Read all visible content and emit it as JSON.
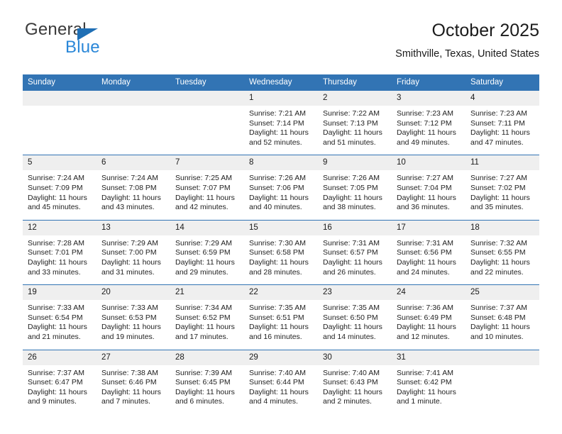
{
  "brand": {
    "name_part1": "General",
    "name_part2": "Blue",
    "logo_icon": "blue-triangle-logo"
  },
  "header": {
    "title": "October 2025",
    "subtitle": "Smithville, Texas, United States"
  },
  "calendar": {
    "weekday_headers": [
      "Sunday",
      "Monday",
      "Tuesday",
      "Wednesday",
      "Thursday",
      "Friday",
      "Saturday"
    ],
    "colors": {
      "header_blue": "#3274b4",
      "daynum_band": "#efefef",
      "brand_blue": "#2a87d8",
      "logo_blue": "#1f6fb5"
    },
    "weeks": [
      [
        {
          "day": "",
          "empty": true
        },
        {
          "day": "",
          "empty": true
        },
        {
          "day": "",
          "empty": true
        },
        {
          "day": "1",
          "sunrise": "Sunrise: 7:21 AM",
          "sunset": "Sunset: 7:14 PM",
          "daylight_line1": "Daylight: 11 hours",
          "daylight_line2": "and 52 minutes."
        },
        {
          "day": "2",
          "sunrise": "Sunrise: 7:22 AM",
          "sunset": "Sunset: 7:13 PM",
          "daylight_line1": "Daylight: 11 hours",
          "daylight_line2": "and 51 minutes."
        },
        {
          "day": "3",
          "sunrise": "Sunrise: 7:23 AM",
          "sunset": "Sunset: 7:12 PM",
          "daylight_line1": "Daylight: 11 hours",
          "daylight_line2": "and 49 minutes."
        },
        {
          "day": "4",
          "sunrise": "Sunrise: 7:23 AM",
          "sunset": "Sunset: 7:11 PM",
          "daylight_line1": "Daylight: 11 hours",
          "daylight_line2": "and 47 minutes."
        }
      ],
      [
        {
          "day": "5",
          "sunrise": "Sunrise: 7:24 AM",
          "sunset": "Sunset: 7:09 PM",
          "daylight_line1": "Daylight: 11 hours",
          "daylight_line2": "and 45 minutes."
        },
        {
          "day": "6",
          "sunrise": "Sunrise: 7:24 AM",
          "sunset": "Sunset: 7:08 PM",
          "daylight_line1": "Daylight: 11 hours",
          "daylight_line2": "and 43 minutes."
        },
        {
          "day": "7",
          "sunrise": "Sunrise: 7:25 AM",
          "sunset": "Sunset: 7:07 PM",
          "daylight_line1": "Daylight: 11 hours",
          "daylight_line2": "and 42 minutes."
        },
        {
          "day": "8",
          "sunrise": "Sunrise: 7:26 AM",
          "sunset": "Sunset: 7:06 PM",
          "daylight_line1": "Daylight: 11 hours",
          "daylight_line2": "and 40 minutes."
        },
        {
          "day": "9",
          "sunrise": "Sunrise: 7:26 AM",
          "sunset": "Sunset: 7:05 PM",
          "daylight_line1": "Daylight: 11 hours",
          "daylight_line2": "and 38 minutes."
        },
        {
          "day": "10",
          "sunrise": "Sunrise: 7:27 AM",
          "sunset": "Sunset: 7:04 PM",
          "daylight_line1": "Daylight: 11 hours",
          "daylight_line2": "and 36 minutes."
        },
        {
          "day": "11",
          "sunrise": "Sunrise: 7:27 AM",
          "sunset": "Sunset: 7:02 PM",
          "daylight_line1": "Daylight: 11 hours",
          "daylight_line2": "and 35 minutes."
        }
      ],
      [
        {
          "day": "12",
          "sunrise": "Sunrise: 7:28 AM",
          "sunset": "Sunset: 7:01 PM",
          "daylight_line1": "Daylight: 11 hours",
          "daylight_line2": "and 33 minutes."
        },
        {
          "day": "13",
          "sunrise": "Sunrise: 7:29 AM",
          "sunset": "Sunset: 7:00 PM",
          "daylight_line1": "Daylight: 11 hours",
          "daylight_line2": "and 31 minutes."
        },
        {
          "day": "14",
          "sunrise": "Sunrise: 7:29 AM",
          "sunset": "Sunset: 6:59 PM",
          "daylight_line1": "Daylight: 11 hours",
          "daylight_line2": "and 29 minutes."
        },
        {
          "day": "15",
          "sunrise": "Sunrise: 7:30 AM",
          "sunset": "Sunset: 6:58 PM",
          "daylight_line1": "Daylight: 11 hours",
          "daylight_line2": "and 28 minutes."
        },
        {
          "day": "16",
          "sunrise": "Sunrise: 7:31 AM",
          "sunset": "Sunset: 6:57 PM",
          "daylight_line1": "Daylight: 11 hours",
          "daylight_line2": "and 26 minutes."
        },
        {
          "day": "17",
          "sunrise": "Sunrise: 7:31 AM",
          "sunset": "Sunset: 6:56 PM",
          "daylight_line1": "Daylight: 11 hours",
          "daylight_line2": "and 24 minutes."
        },
        {
          "day": "18",
          "sunrise": "Sunrise: 7:32 AM",
          "sunset": "Sunset: 6:55 PM",
          "daylight_line1": "Daylight: 11 hours",
          "daylight_line2": "and 22 minutes."
        }
      ],
      [
        {
          "day": "19",
          "sunrise": "Sunrise: 7:33 AM",
          "sunset": "Sunset: 6:54 PM",
          "daylight_line1": "Daylight: 11 hours",
          "daylight_line2": "and 21 minutes."
        },
        {
          "day": "20",
          "sunrise": "Sunrise: 7:33 AM",
          "sunset": "Sunset: 6:53 PM",
          "daylight_line1": "Daylight: 11 hours",
          "daylight_line2": "and 19 minutes."
        },
        {
          "day": "21",
          "sunrise": "Sunrise: 7:34 AM",
          "sunset": "Sunset: 6:52 PM",
          "daylight_line1": "Daylight: 11 hours",
          "daylight_line2": "and 17 minutes."
        },
        {
          "day": "22",
          "sunrise": "Sunrise: 7:35 AM",
          "sunset": "Sunset: 6:51 PM",
          "daylight_line1": "Daylight: 11 hours",
          "daylight_line2": "and 16 minutes."
        },
        {
          "day": "23",
          "sunrise": "Sunrise: 7:35 AM",
          "sunset": "Sunset: 6:50 PM",
          "daylight_line1": "Daylight: 11 hours",
          "daylight_line2": "and 14 minutes."
        },
        {
          "day": "24",
          "sunrise": "Sunrise: 7:36 AM",
          "sunset": "Sunset: 6:49 PM",
          "daylight_line1": "Daylight: 11 hours",
          "daylight_line2": "and 12 minutes."
        },
        {
          "day": "25",
          "sunrise": "Sunrise: 7:37 AM",
          "sunset": "Sunset: 6:48 PM",
          "daylight_line1": "Daylight: 11 hours",
          "daylight_line2": "and 10 minutes."
        }
      ],
      [
        {
          "day": "26",
          "sunrise": "Sunrise: 7:37 AM",
          "sunset": "Sunset: 6:47 PM",
          "daylight_line1": "Daylight: 11 hours",
          "daylight_line2": "and 9 minutes."
        },
        {
          "day": "27",
          "sunrise": "Sunrise: 7:38 AM",
          "sunset": "Sunset: 6:46 PM",
          "daylight_line1": "Daylight: 11 hours",
          "daylight_line2": "and 7 minutes."
        },
        {
          "day": "28",
          "sunrise": "Sunrise: 7:39 AM",
          "sunset": "Sunset: 6:45 PM",
          "daylight_line1": "Daylight: 11 hours",
          "daylight_line2": "and 6 minutes."
        },
        {
          "day": "29",
          "sunrise": "Sunrise: 7:40 AM",
          "sunset": "Sunset: 6:44 PM",
          "daylight_line1": "Daylight: 11 hours",
          "daylight_line2": "and 4 minutes."
        },
        {
          "day": "30",
          "sunrise": "Sunrise: 7:40 AM",
          "sunset": "Sunset: 6:43 PM",
          "daylight_line1": "Daylight: 11 hours",
          "daylight_line2": "and 2 minutes."
        },
        {
          "day": "31",
          "sunrise": "Sunrise: 7:41 AM",
          "sunset": "Sunset: 6:42 PM",
          "daylight_line1": "Daylight: 11 hours",
          "daylight_line2": "and 1 minute."
        },
        {
          "day": "",
          "empty": true
        }
      ]
    ]
  }
}
